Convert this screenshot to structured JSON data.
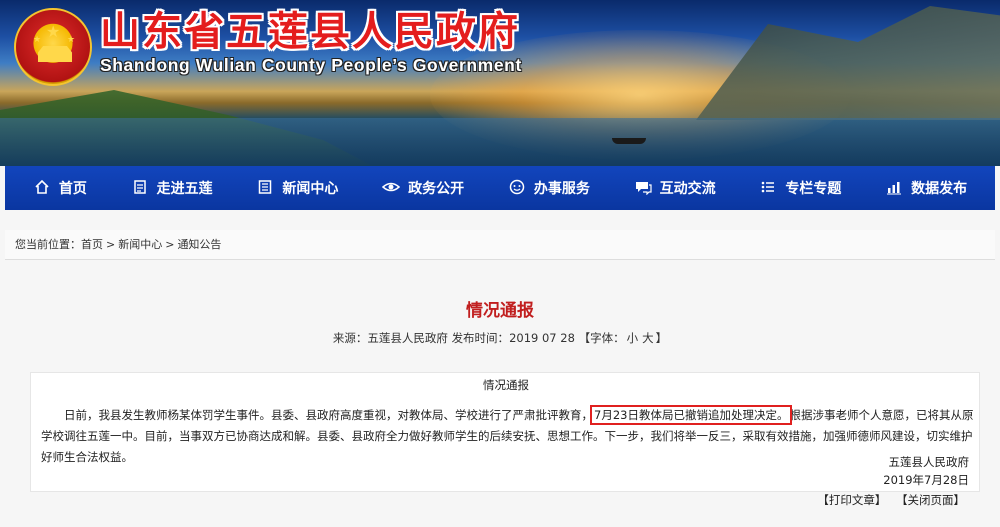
{
  "header": {
    "title_cn": "山东省五莲县人民政府",
    "title_en": "Shandong Wulian County People’s Government"
  },
  "nav": {
    "items": [
      {
        "label": "首页",
        "icon": "home-icon"
      },
      {
        "label": "走进五莲",
        "icon": "document-icon"
      },
      {
        "label": "新闻中心",
        "icon": "news-icon"
      },
      {
        "label": "政务公开",
        "icon": "eye-icon"
      },
      {
        "label": "办事服务",
        "icon": "service-icon"
      },
      {
        "label": "互动交流",
        "icon": "chat-icon"
      },
      {
        "label": "专栏专题",
        "icon": "list-icon"
      },
      {
        "label": "数据发布",
        "icon": "chart-icon"
      }
    ]
  },
  "breadcrumb": {
    "prefix": "您当前位置：",
    "items": [
      "首页",
      "新闻中心",
      "通知公告"
    ],
    "separator": ">"
  },
  "article": {
    "title": "情况通报",
    "meta_source_label": "来源：",
    "meta_source": "五莲县人民政府",
    "meta_time_label": "发布时间：",
    "meta_time": "2019 07 28",
    "meta_font_label": "【字体：",
    "meta_font_small": "小",
    "meta_font_large": "大",
    "meta_font_close": "】",
    "doc_heading": "情况通报",
    "body_before": "日前，我县发生教师杨某体罚学生事件。县委、县政府高度重视，对教体局、学校进行了严肃批评教育，",
    "body_highlight": "7月23日教体局已撤销追加处理决定。",
    "body_after": "根据涉事老师个人意愿，已将其从原学校调往五莲一中。目前，当事双方已协商达成和解。县委、县政府全力做好教师学生的后续安抚、思想工作。下一步，我们将举一反三，采取有效措施，加强师德师风建设，切实维护好师生合法权益。",
    "signature_org": "五莲县人民政府",
    "signature_date": "2019年7月28日",
    "print_label": "【打印文章】",
    "close_label": "【关闭页面】"
  },
  "colors": {
    "nav_bg": "#0a36a0",
    "title_red": "#c11f1f",
    "highlight_border": "#e0201f"
  }
}
